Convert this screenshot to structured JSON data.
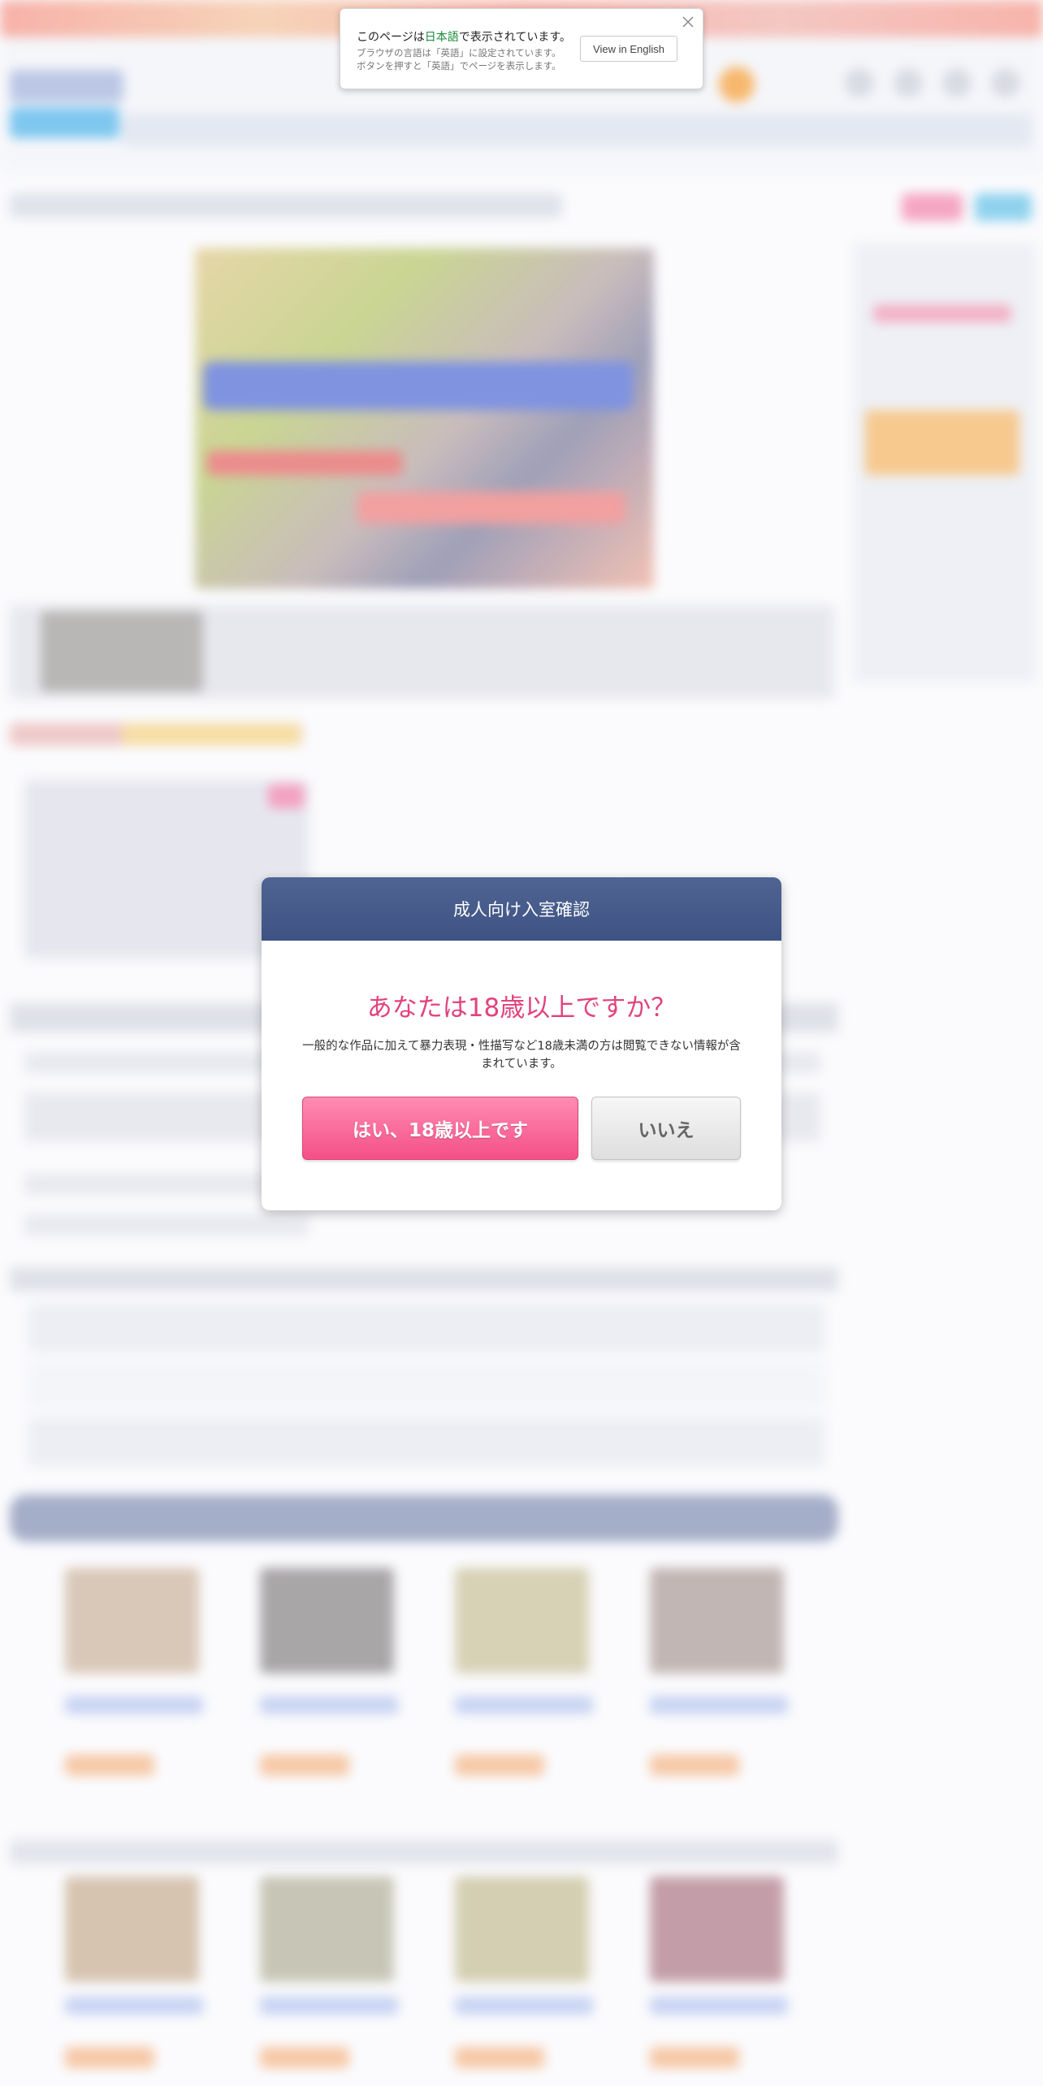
{
  "translate_bar": {
    "message_prefix": "このページは",
    "language": "日本語",
    "message_suffix": "で表示されています。",
    "sub_line1": "ブラウザの言語は「英語」に設定されています。",
    "sub_line2": "ボタンを押すと「英語」でページを表示します。",
    "button_label": "View in English",
    "close_icon": "close-icon"
  },
  "age_modal": {
    "title": "成人向け入室確認",
    "question": "あなたは18歳以上ですか？",
    "description": "一般的な作品に加えて暴力表現・性描写など18歳未満の方は閲覧できない情報が含まれています。",
    "yes_label": "はい、18歳以上です",
    "no_label": "いいえ"
  },
  "colors": {
    "modal_header": "#44598a",
    "question_text": "#e2437d",
    "yes_button": "#f55d90",
    "no_button": "#e6e6e6",
    "language_highlight": "#1a8a3b"
  }
}
